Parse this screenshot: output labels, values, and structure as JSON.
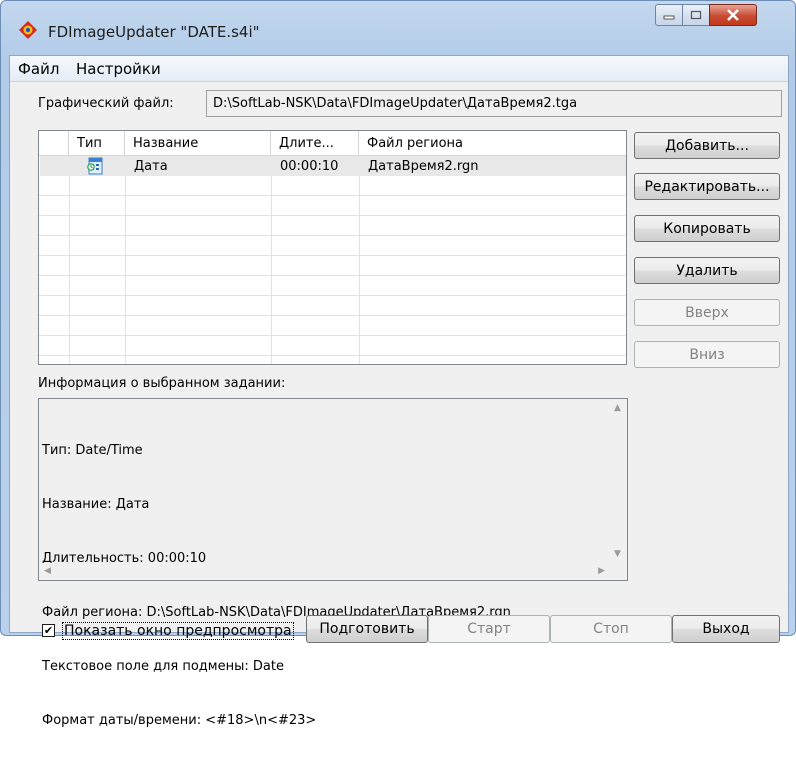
{
  "window": {
    "title": "FDImageUpdater \"DATE.s4i\""
  },
  "menu": [
    "Файл",
    "Настройки"
  ],
  "graphic_file": {
    "label": "Графический файл:",
    "value": "D:\\SoftLab-NSK\\Data\\FDImageUpdater\\ДатаВремя2.tga"
  },
  "task_list": {
    "columns": [
      "Тип",
      "Название",
      "Длите...",
      "Файл региона"
    ],
    "rows": [
      {
        "type_icon": "date-time-task-icon",
        "name": "Дата",
        "duration": "00:00:10",
        "region_file": "ДатаВремя2.rgn"
      }
    ]
  },
  "side_buttons": {
    "add": "Добавить...",
    "edit": "Редактировать...",
    "copy": "Копировать",
    "delete": "Удалить",
    "up": "Вверх",
    "down": "Вниз"
  },
  "info": {
    "label": "Информация о выбранном задании:",
    "lines": [
      "Тип: Date/Time",
      "Название: Дата",
      "Длительность: 00:00:10",
      "Файл региона: D:\\SoftLab-NSK\\Data\\FDImageUpdater\\ДатаВремя2.rgn",
      "Текстовое поле для подмены: Date",
      "Формат даты/времени: <#18>\\n<#23>"
    ]
  },
  "preview_checkbox": {
    "label": "Показать окно предпросмотра",
    "checked": true
  },
  "bottom_buttons": {
    "prepare": "Подготовить",
    "start": "Старт",
    "stop": "Стоп",
    "exit": "Выход"
  },
  "colors": {
    "title_bar": "#b9d1ec",
    "close_button": "#c74c34",
    "selected_row": "#e8e8e8"
  }
}
